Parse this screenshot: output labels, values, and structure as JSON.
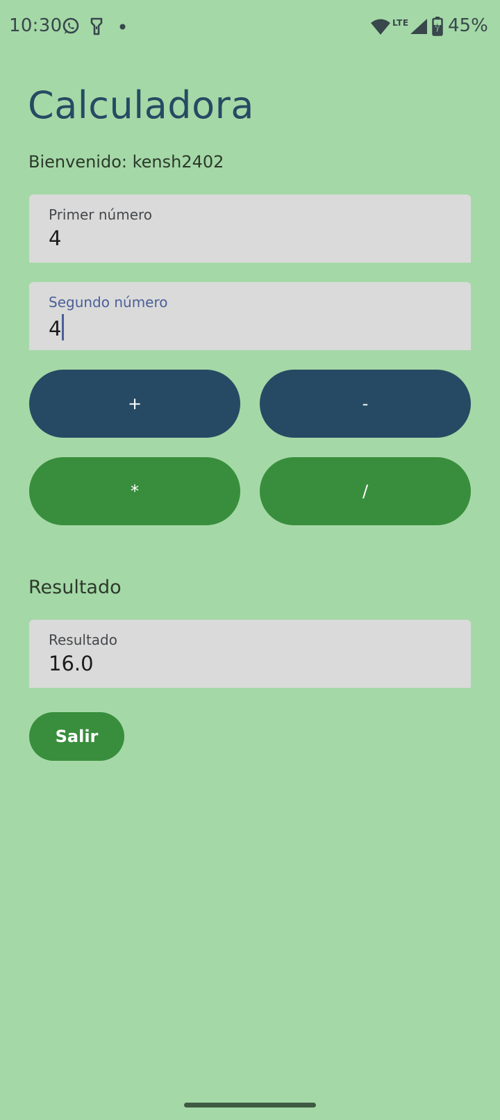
{
  "status_bar": {
    "time": "10:30",
    "network_label": "LTE",
    "battery_percent": "45%",
    "icons": [
      "whatsapp-icon",
      "flashlight-icon",
      "notification-dot-icon",
      "wifi-icon",
      "signal-icon",
      "battery-charging-icon"
    ]
  },
  "app": {
    "title": "Calculadora",
    "welcome": "Bienvenido: kensh2402"
  },
  "inputs": {
    "first": {
      "label": "Primer número",
      "value": "4"
    },
    "second": {
      "label": "Segundo número",
      "value": "4",
      "focused": true
    }
  },
  "operations": {
    "add": "+",
    "subtract": "-",
    "multiply": "*",
    "divide": "/"
  },
  "result": {
    "heading": "Resultado",
    "label": "Resultado",
    "value": "16.0"
  },
  "actions": {
    "exit_label": "Salir"
  },
  "colors": {
    "background": "#a5d8a7",
    "primary_blue": "#264a63",
    "primary_green": "#388e3c",
    "field_background": "#dadada",
    "focus_accent": "#4a5f98"
  }
}
